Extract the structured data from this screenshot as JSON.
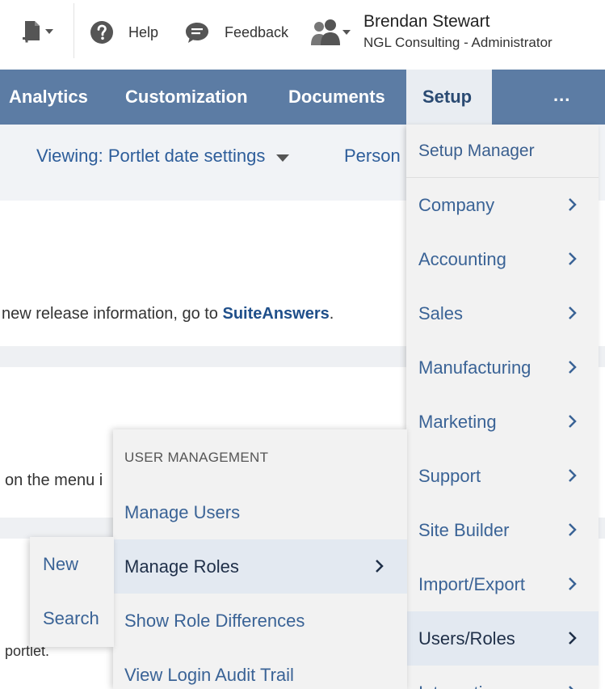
{
  "header": {
    "help_label": "Help",
    "feedback_label": "Feedback",
    "user_name": "Brendan Stewart",
    "user_role": "NGL Consulting - Administrator"
  },
  "nav": {
    "items": [
      "Analytics",
      "Customization",
      "Documents",
      "Setup"
    ],
    "active": "Setup",
    "more_label": "..."
  },
  "subbar": {
    "viewing_label": "Viewing: Portlet date settings",
    "personal_label": "Person"
  },
  "content": {
    "release_prefix": "new release information, go to ",
    "release_link": "SuiteAnswers",
    "release_suffix": ".",
    "menu_text": "on the menu i",
    "portlet_text": "portlet."
  },
  "setup_menu": {
    "header": "Setup Manager",
    "items": [
      "Company",
      "Accounting",
      "Sales",
      "Manufacturing",
      "Marketing",
      "Support",
      "Site Builder",
      "Import/Export",
      "Users/Roles",
      "Integration"
    ],
    "active": "Users/Roles"
  },
  "user_management_menu": {
    "header": "USER MANAGEMENT",
    "items": [
      "Manage Users",
      "Manage Roles",
      "Show Role Differences",
      "View Login Audit Trail"
    ],
    "active": "Manage Roles"
  },
  "roles_submenu": {
    "items": [
      "New",
      "Search"
    ]
  },
  "colors": {
    "nav_bg": "#5c7ca4",
    "link_blue": "#3a6396",
    "menu_bg": "#f2f2f2",
    "active_bg": "#e3e9f1"
  }
}
